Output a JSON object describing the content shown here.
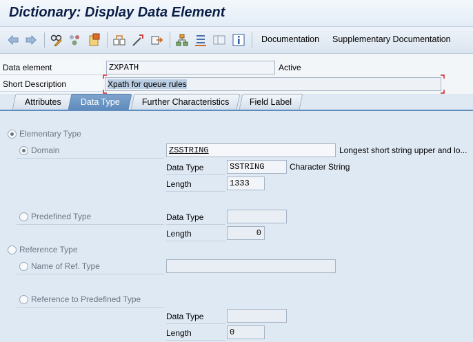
{
  "window": {
    "title": "Dictionary: Display Data Element"
  },
  "toolbar": {
    "icons": [
      "back-arrow-icon",
      "forward-arrow-icon",
      "display-change-icon",
      "other-object-icon",
      "activate-icon",
      "check-icon",
      "where-used-icon",
      "edit-object-icon",
      "navigate-icon",
      "hierarchy-icon",
      "list-icon",
      "layout-icon",
      "info-icon"
    ],
    "documentation_label": "Documentation",
    "supplementary_label": "Supplementary Documentation"
  },
  "header": {
    "data_element_label": "Data element",
    "data_element_value": "ZXPATH",
    "status": "Active",
    "short_desc_label": "Short Description",
    "short_desc_value": "Xpath for queue rules"
  },
  "tabs": [
    {
      "label": "Attributes",
      "active": false
    },
    {
      "label": "Data Type",
      "active": true
    },
    {
      "label": "Further Characteristics",
      "active": false
    },
    {
      "label": "Field Label",
      "active": false
    }
  ],
  "content": {
    "elementary_type_label": "Elementary Type",
    "domain_label": "Domain",
    "domain_value": "ZSSTRING",
    "domain_desc": "Longest short string upper and lo...",
    "data_type_label": "Data Type",
    "data_type_value": "SSTRING",
    "data_type_desc": "Character String",
    "length_label": "Length",
    "length_value": "1333",
    "predefined_type_label": "Predefined Type",
    "predef_data_type_label": "Data Type",
    "predef_data_type_value": "",
    "predef_length_label": "Length",
    "predef_length_value": "0",
    "reference_type_label": "Reference Type",
    "ref_name_label": "Name of Ref. Type",
    "ref_name_value": "",
    "ref_predef_label": "Reference to Predefined Type",
    "ref_data_type_label": "Data Type",
    "ref_data_type_value": "",
    "ref_length_label": "Length",
    "ref_length_value": "0"
  }
}
